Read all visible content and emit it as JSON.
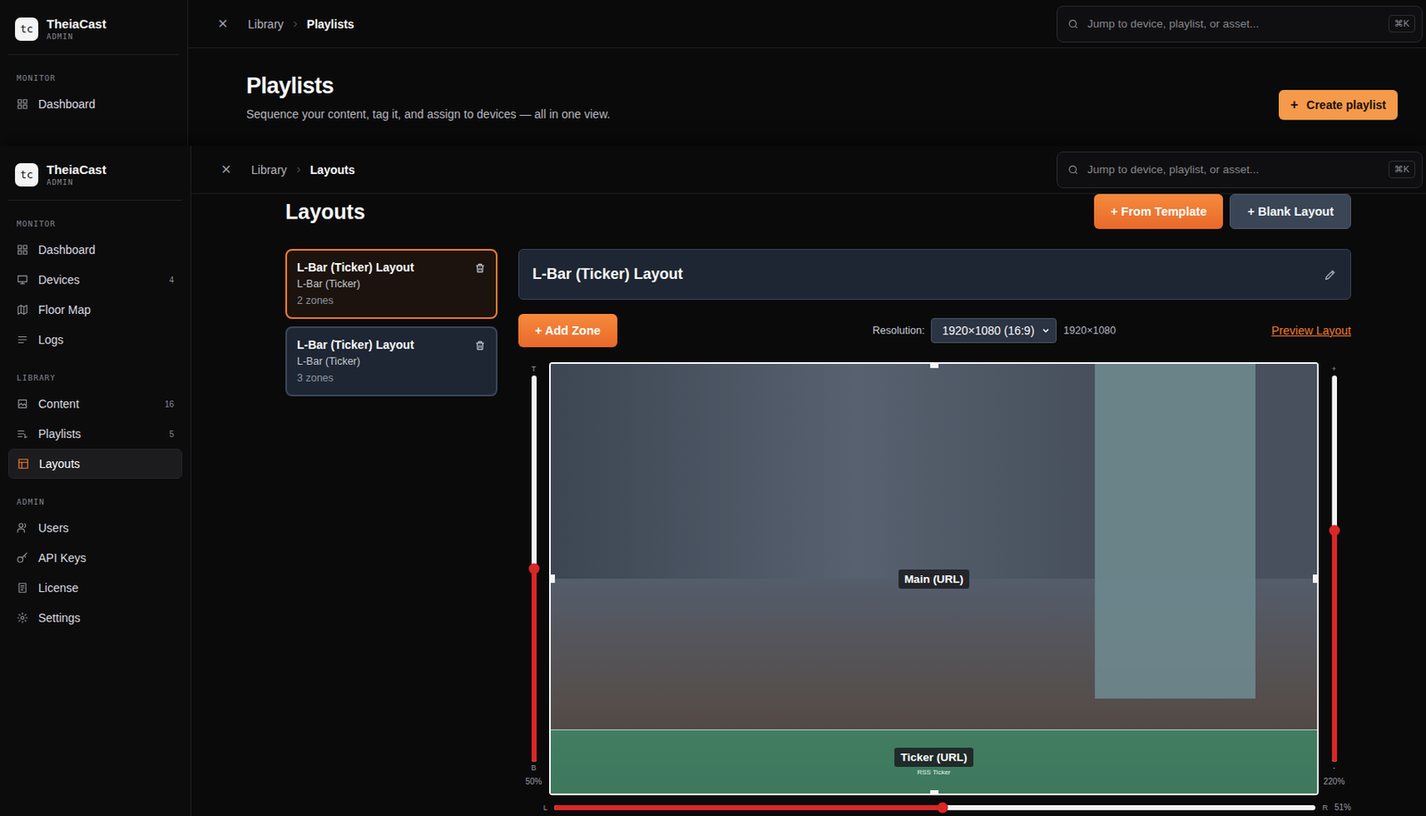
{
  "back_window": {
    "brand": {
      "logo": "tc",
      "name": "TheiaCast",
      "role": "ADMIN"
    },
    "sidebar": [
      {
        "section": "MONITOR",
        "items": [
          {
            "label": "Dashboard",
            "count": "",
            "selected": false
          }
        ]
      }
    ],
    "topbar": {
      "close": "×",
      "breadcrumb": [
        "Library",
        "Playlists"
      ],
      "search": {
        "placeholder": "Jump to device, playlist, or asset...",
        "shortcut": "⌘K"
      }
    },
    "page": {
      "title": "Playlists",
      "subtitle": "Sequence your content, tag it, and assign to devices — all in one view.",
      "create_button": {
        "icon": "+",
        "label": "Create playlist"
      }
    }
  },
  "front_window": {
    "brand": {
      "logo": "tc",
      "name": "TheiaCast",
      "role": "ADMIN"
    },
    "sidebar": [
      {
        "section": "MONITOR",
        "items": [
          {
            "label": "Dashboard",
            "count": "",
            "selected": false
          },
          {
            "label": "Devices",
            "count": "4",
            "selected": false
          },
          {
            "label": "Floor Map",
            "count": "",
            "selected": false
          },
          {
            "label": "Logs",
            "count": "",
            "selected": false
          }
        ]
      },
      {
        "section": "LIBRARY",
        "items": [
          {
            "label": "Content",
            "count": "16",
            "selected": false
          },
          {
            "label": "Playlists",
            "count": "5",
            "selected": false
          },
          {
            "label": "Layouts",
            "count": "",
            "selected": true
          }
        ]
      },
      {
        "section": "ADMIN",
        "items": [
          {
            "label": "Users",
            "count": "",
            "selected": false
          },
          {
            "label": "API Keys",
            "count": "",
            "selected": false
          },
          {
            "label": "License",
            "count": "",
            "selected": false
          },
          {
            "label": "Settings",
            "count": "",
            "selected": false
          }
        ]
      }
    ],
    "topbar": {
      "close": "×",
      "breadcrumb": [
        "Library",
        "Layouts"
      ],
      "search": {
        "placeholder": "Jump to device, playlist, or asset...",
        "shortcut": "⌘K"
      }
    },
    "page": {
      "title": "Layouts",
      "buttons": [
        {
          "label": "+ From Template",
          "kind": "primary"
        },
        {
          "label": "+ Blank Layout",
          "kind": "secondary"
        }
      ],
      "layouts": [
        {
          "name": "L-Bar (Ticker) Layout",
          "template": "L-Bar (Ticker)",
          "zones": "2 zones",
          "selected": true
        },
        {
          "name": "L-Bar (Ticker) Layout",
          "template": "L-Bar (Ticker)",
          "zones": "3 zones",
          "selected": false
        }
      ],
      "editor": {
        "name": "L-Bar (Ticker) Layout",
        "add_zone": "+ Add Zone",
        "resolution_label": "Resolution:",
        "resolution_value": "1920×1080 (16:9)",
        "resolution_text": "1920×1080",
        "preview": "Preview Layout",
        "zones": [
          {
            "label": "Main (URL)",
            "content": "",
            "kind": "main",
            "color": "#0f172a"
          },
          {
            "label": "Ticker (URL)",
            "content": "RSS Ticker",
            "kind": "ticker",
            "color": "#34a878"
          }
        ],
        "slider_left": {
          "start_label": "T",
          "end_label": "B",
          "reading": "50%",
          "level": 0.5
        },
        "slider_right": {
          "start_label": "+",
          "end_label": "-",
          "reading": "220%",
          "level": 0.6
        },
        "slider_bottom": {
          "start_label": "L",
          "end_label": "R",
          "reading": "51%",
          "level": 0.51
        }
      }
    }
  }
}
